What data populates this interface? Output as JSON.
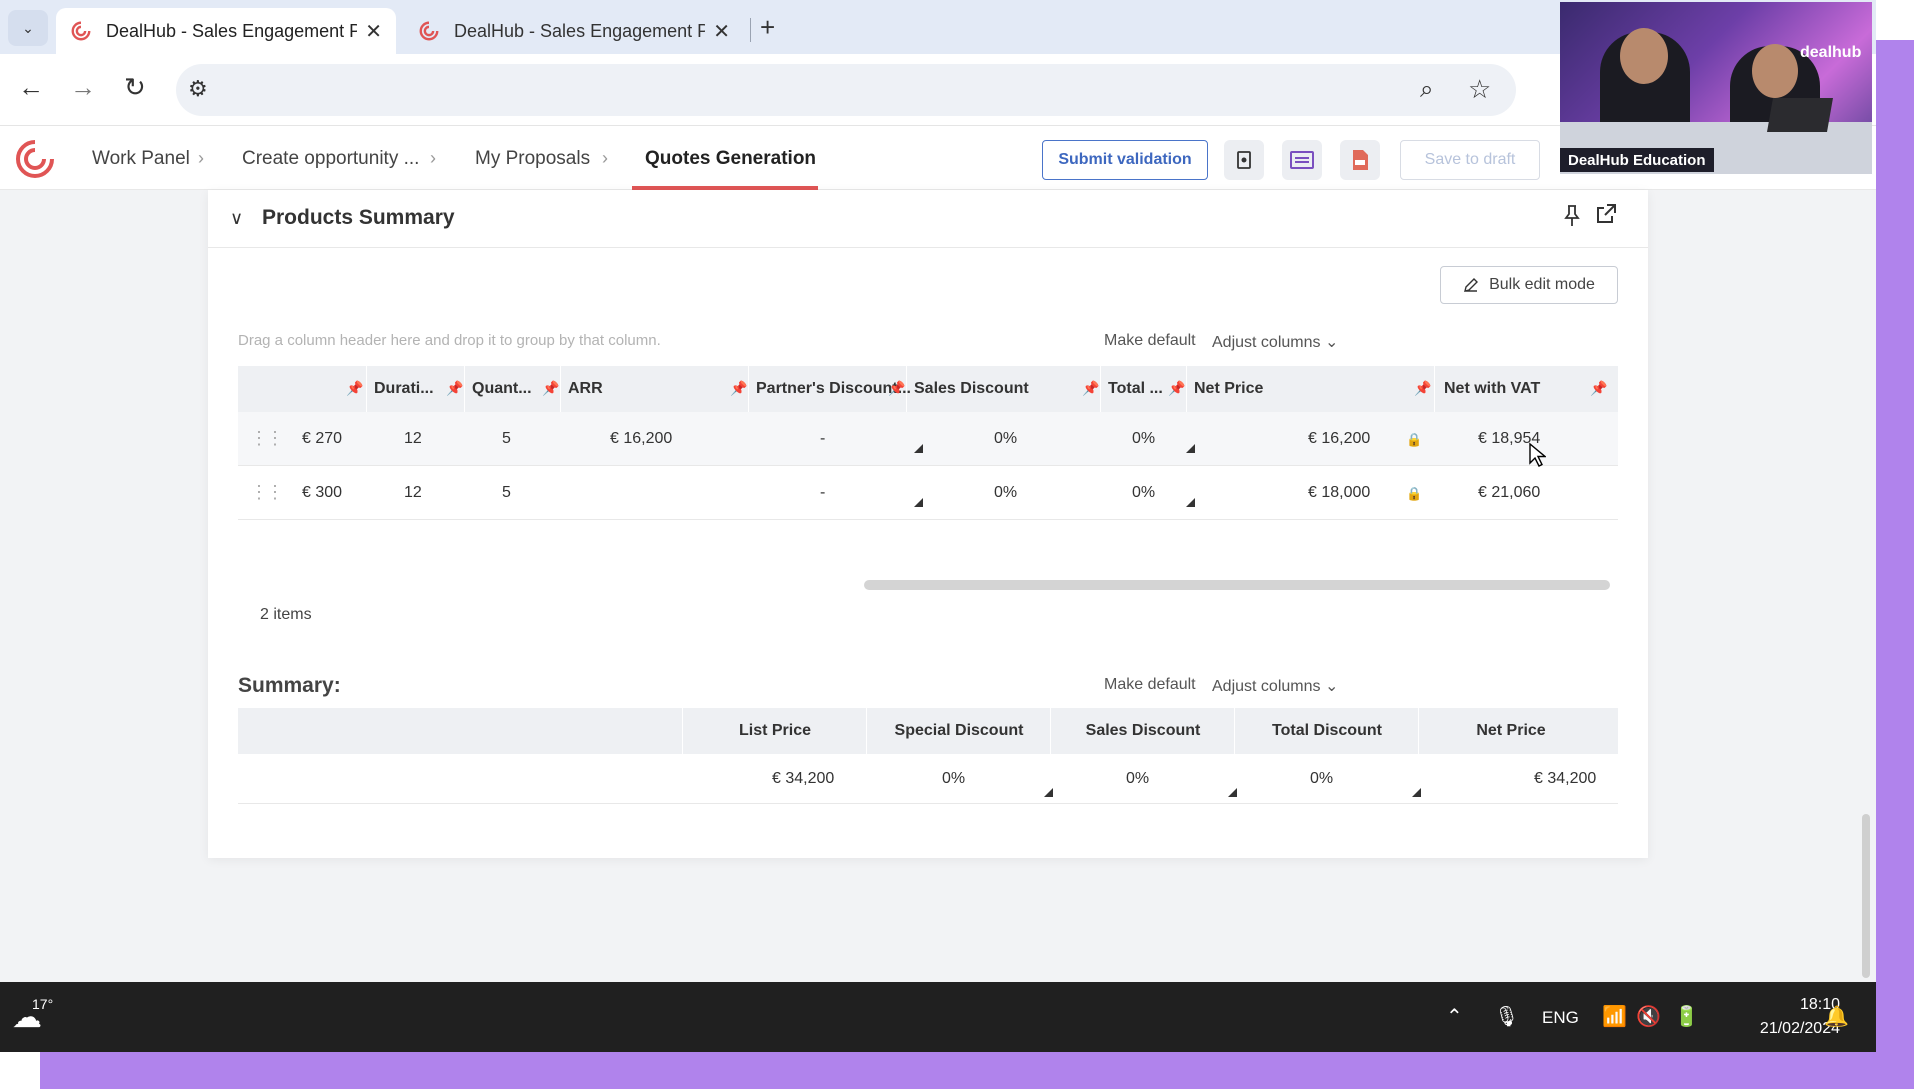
{
  "browser": {
    "tabs": [
      {
        "title": "DealHub - Sales Engagement Pl",
        "active": true
      },
      {
        "title": "DealHub - Sales Engagement Pl",
        "active": false
      }
    ],
    "new_tab": "+",
    "close_glyph": "✕"
  },
  "app": {
    "breadcrumbs": [
      "Work Panel",
      "Create opportunity ...",
      "My Proposals",
      "Quotes Generation"
    ],
    "submit_label": "Submit validation",
    "save_draft_label": "Save to draft",
    "accent_color": "#e05555",
    "link_color": "#3d67bf"
  },
  "products_summary": {
    "title": "Products Summary",
    "bulk_edit_label": "Bulk edit mode",
    "drag_hint": "Drag a column header here and drop it to group by that column.",
    "make_default": "Make default",
    "adjust_columns": "Adjust columns",
    "columns": [
      "Durati...",
      "Quant...",
      "ARR",
      "Partner's Discount...",
      "Sales Discount",
      "Total ...",
      "Net Price",
      "Net with VAT"
    ],
    "rows": [
      {
        "price": "€ 270",
        "duration": "12",
        "quantity": "5",
        "arr": "€ 16,200",
        "partner_discount": "-",
        "sales_discount": "0%",
        "total_discount": "0%",
        "net_price": "€ 16,200",
        "net_vat": "€ 18,954"
      },
      {
        "price": "€ 300",
        "duration": "12",
        "quantity": "5",
        "arr": "",
        "partner_discount": "-",
        "sales_discount": "0%",
        "total_discount": "0%",
        "net_price": "€ 18,000",
        "net_vat": "€ 21,060"
      }
    ],
    "items_count": "2 items"
  },
  "summary": {
    "title": "Summary:",
    "make_default": "Make default",
    "adjust_columns": "Adjust columns",
    "columns": [
      "List Price",
      "Special Discount",
      "Sales Discount",
      "Total Discount",
      "Net Price"
    ],
    "row": {
      "list_price": "€ 34,200",
      "special_discount": "0%",
      "sales_discount": "0%",
      "total_discount": "0%",
      "net_price": "€ 34,200"
    }
  },
  "taskbar": {
    "temperature": "17°",
    "language": "ENG",
    "time": "18:10",
    "date": "21/02/2024"
  },
  "webcam": {
    "label": "DealHub Education",
    "brand": "dealhub"
  }
}
